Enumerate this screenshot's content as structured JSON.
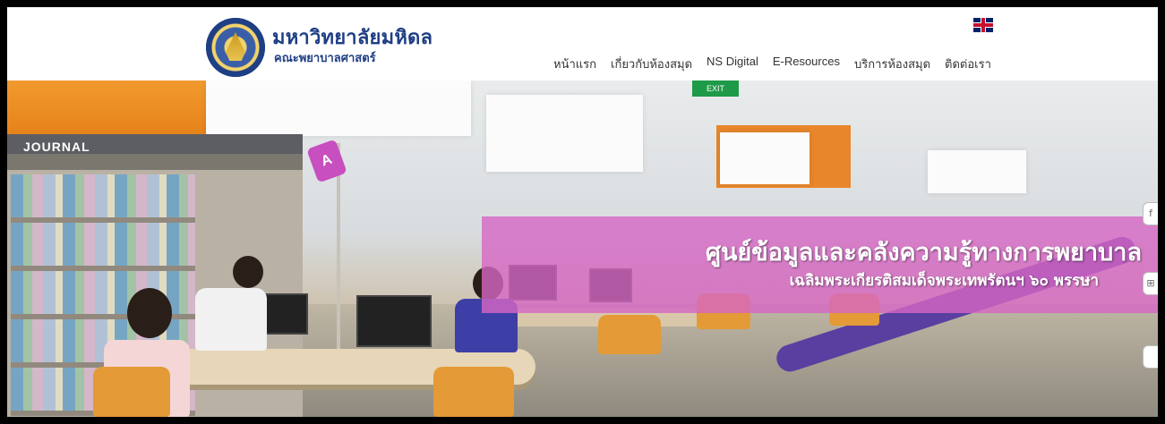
{
  "brand": {
    "title": "มหาวิทยาลัยมหิดล",
    "subtitle": "คณะพยาบาลศาสตร์"
  },
  "language_flag": "uk-flag-icon",
  "nav": {
    "items": [
      {
        "label": "หน้าแรก"
      },
      {
        "label": "เกี่ยวกับห้องสมุด"
      },
      {
        "label": "NS Digital"
      },
      {
        "label": "E-Resources"
      },
      {
        "label": "บริการห้องสมุด"
      },
      {
        "label": "ติดต่อเรา"
      }
    ]
  },
  "hero": {
    "shelf_sign": "JOURNAL",
    "exit_sign": "EXIT",
    "pin_letter": "A",
    "banner_title": "ศูนย์ข้อมูลและคลังความรู้ทางการพยาบาล",
    "banner_subtitle": "เฉลิมพระเกียรติสมเด็จพระเทพรัตนฯ ๖๐ พรรษา"
  },
  "colors": {
    "brand_blue": "#1f3f85",
    "banner_pink": "#d666c4",
    "ceiling_orange": "#e8862b"
  }
}
